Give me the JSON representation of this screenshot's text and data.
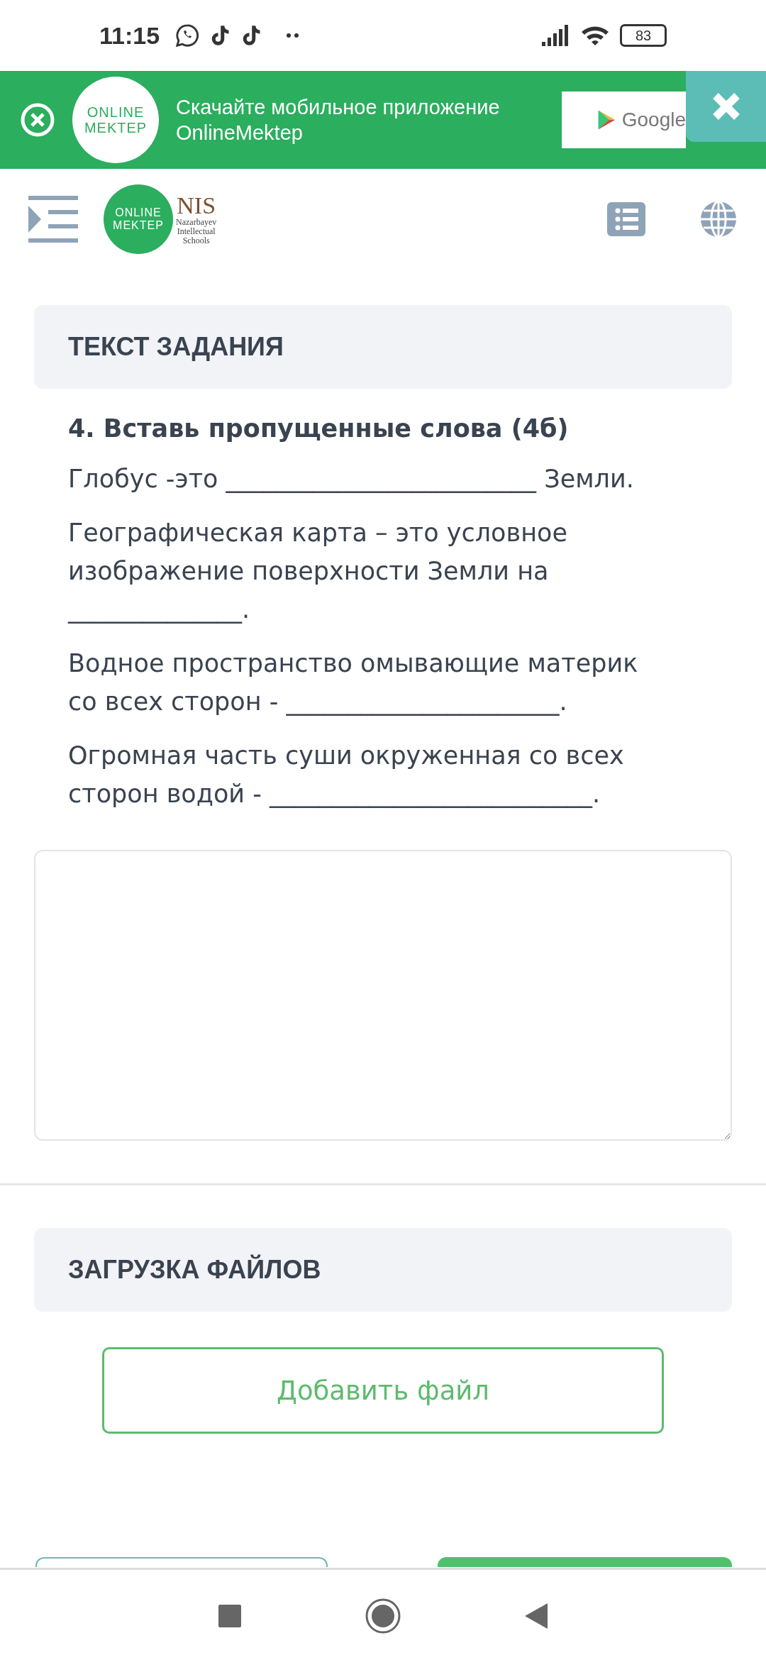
{
  "status_bar": {
    "time": "11:15",
    "battery": "83"
  },
  "app_banner": {
    "logo_lines": [
      "ONLINE",
      "MEKTEP"
    ],
    "message": "Скачайте мобильное приложение OnlineMektep",
    "store_badge": "Google"
  },
  "header": {
    "logo_lines": [
      "ONLINE",
      "MEKTEP"
    ],
    "partner_logo": {
      "title": "NIS",
      "subtitle_lines": [
        "Nazarbayev",
        "Intellectual",
        "Schools"
      ]
    }
  },
  "task_section": {
    "heading": "ТЕКСТ ЗАДАНИЯ",
    "question_title": "4. Вставь пропущенные слова (4б)",
    "paragraphs": [
      "Глобус -это _________________________ Земли.",
      "Географическая карта – это условное изображение поверхности Земли на ______________.",
      "Водное пространство омывающие материк со всех сторон - ______________________.",
      "Огромная часть суши окруженная со всех сторон водой - __________________________."
    ]
  },
  "upload_section": {
    "heading": "ЗАГРУЗКА ФАЙЛОВ",
    "add_button": "Добавить файл"
  },
  "bottom_buttons": [
    {
      "kind": "outline"
    },
    {
      "kind": "filled"
    }
  ]
}
